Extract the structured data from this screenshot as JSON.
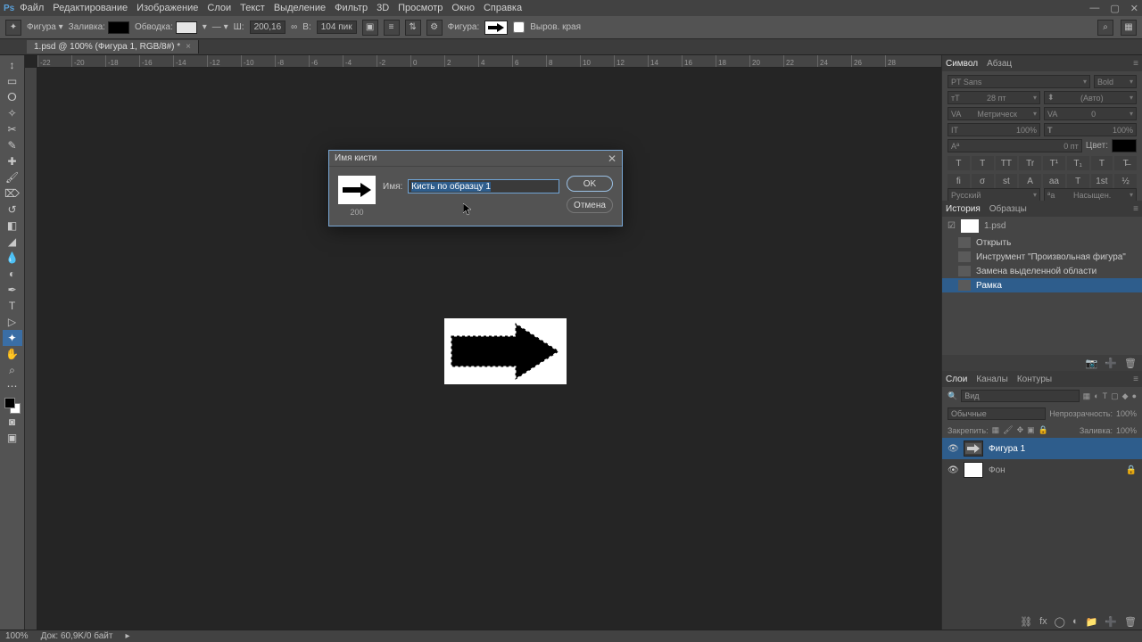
{
  "app": {
    "name": "Ps"
  },
  "menu": [
    "Файл",
    "Редактирование",
    "Изображение",
    "Слои",
    "Текст",
    "Выделение",
    "Фильтр",
    "3D",
    "Просмотр",
    "Окно",
    "Справка"
  ],
  "options": {
    "fill_label": "Заливка:",
    "stroke_label": "Обводка:",
    "w_label": "Ш:",
    "w_value": "200,16",
    "link": "∞",
    "h_label": "В:",
    "h_value": "104 пик",
    "shape_label": "Фигура:",
    "align_label": "Выров. края"
  },
  "document": {
    "tab": "1.psd @ 100% (Фигура 1, RGB/8#) *"
  },
  "ruler_ticks": [
    -22,
    -20,
    -18,
    -16,
    -14,
    -12,
    -10,
    -8,
    -6,
    -4,
    -2,
    0,
    2,
    4,
    6,
    8,
    10,
    12,
    14,
    16,
    18,
    20,
    22,
    24,
    26,
    28
  ],
  "dialog": {
    "title": "Имя кисти",
    "name_label": "Имя:",
    "name_value": "Кисть по образцу 1",
    "preview_size": "200",
    "ok": "OK",
    "cancel": "Отмена"
  },
  "panels": {
    "character": {
      "tabs": [
        "Символ",
        "Абзац"
      ],
      "font": "PT Sans",
      "style": "Bold",
      "size": "28 пт",
      "leading": "(Авто)",
      "tracking_label": "VA",
      "tracking": "Метрическ",
      "kerning": "0",
      "vscale": "100%",
      "hscale": "100%",
      "baseline": "0 пт",
      "color_label": "Цвет:",
      "style_icons": [
        "T",
        "T",
        "TT",
        "Tr",
        "T¹",
        "T₁",
        "T",
        "T̶"
      ],
      "ot_icons": [
        "fi",
        "σ",
        "st",
        "A",
        "aa",
        "T",
        "1st",
        "½"
      ],
      "lang": "Русский",
      "aa": "Насыщен."
    },
    "history": {
      "tabs": [
        "История",
        "Образцы"
      ],
      "doc": "1.psd",
      "items": [
        "Открыть",
        "Инструмент \"Произвольная фигура\"",
        "Замена выделенной области",
        "Рамка"
      ]
    },
    "layers": {
      "tabs": [
        "Слои",
        "Каналы",
        "Контуры"
      ],
      "search_placeholder": "Вид",
      "blend": "Обычные",
      "opacity_label": "Непрозрачность:",
      "opacity": "100%",
      "lock_label": "Закрепить:",
      "fill_label": "Заливка:",
      "fill": "100%",
      "items": [
        {
          "name": "Фигура 1",
          "selected": true,
          "thumb": "arrow"
        },
        {
          "name": "Фон",
          "selected": false,
          "thumb": "white",
          "locked": true
        }
      ]
    }
  },
  "status": {
    "zoom": "100%",
    "docinfo": "Док: 60,9K/0 байт"
  }
}
